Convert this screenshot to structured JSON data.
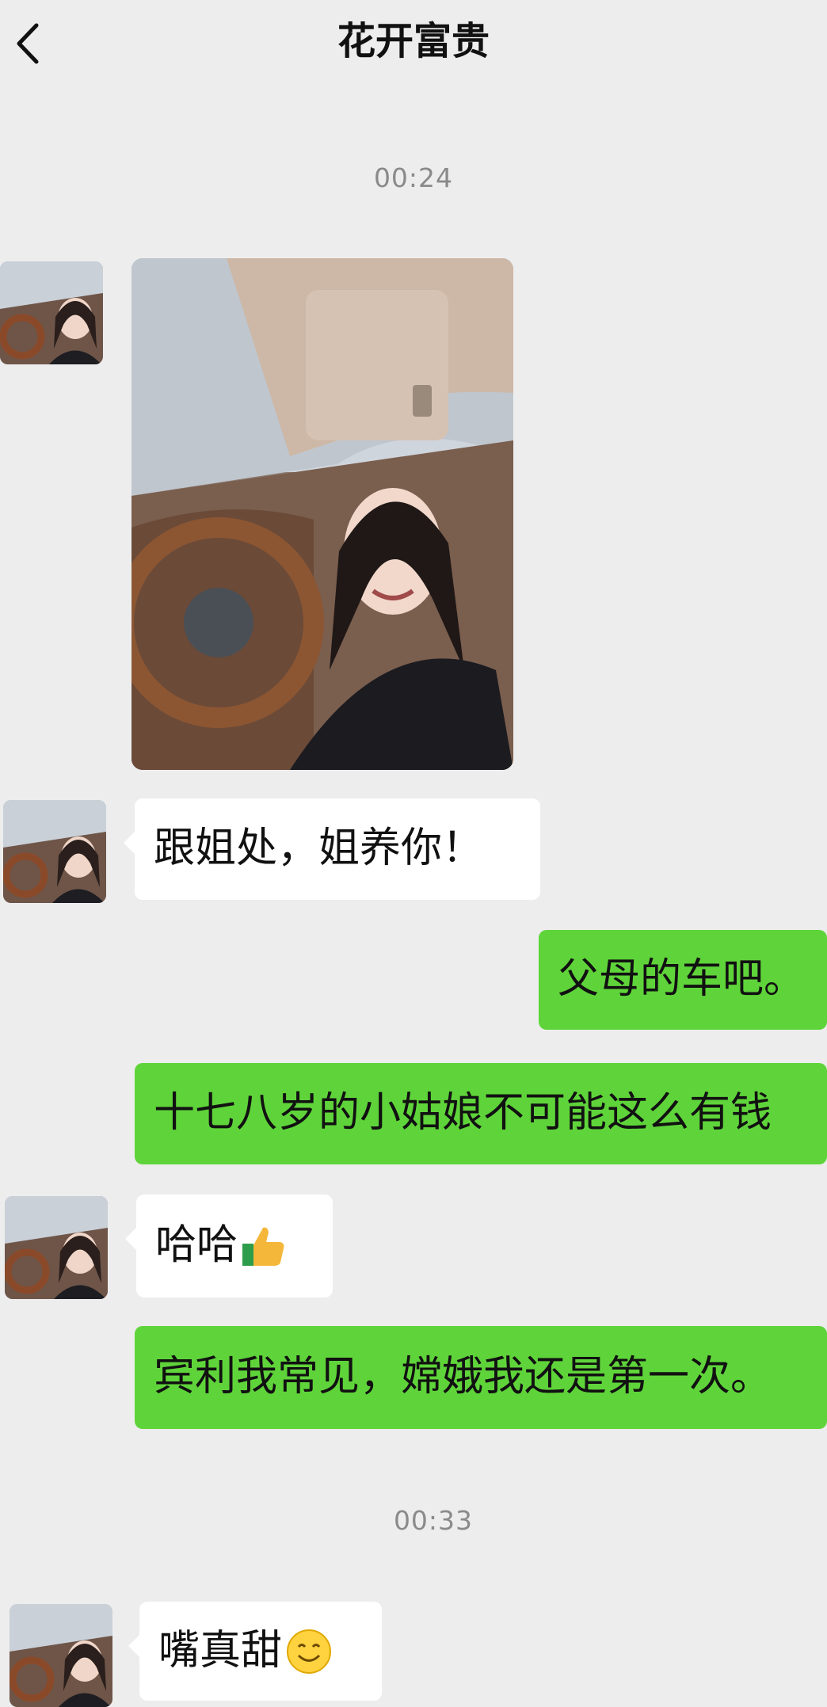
{
  "header": {
    "back_icon": "chevron-left-icon",
    "title": "花开富贵"
  },
  "messages": {
    "timestamp_1": "00:24",
    "photo_alt": "车内自拍照片",
    "msg_1": "跟姐处，姐养你！",
    "msg_2": "父母的车吧。",
    "msg_3": "十七八岁的小姑娘不可能这么有钱",
    "msg_4": "哈哈",
    "msg_4_emoji": "thumbs-up-icon",
    "msg_5": "宾利我常见，嫦娥我还是第一次。",
    "timestamp_2": "00:33",
    "msg_6": "嘴真甜",
    "msg_6_emoji": "smile-emoji-icon"
  },
  "colors": {
    "background": "#ededed",
    "outgoing_bubble": "#5fd43a",
    "incoming_bubble": "#ffffff",
    "timestamp": "#8a8a8a"
  }
}
